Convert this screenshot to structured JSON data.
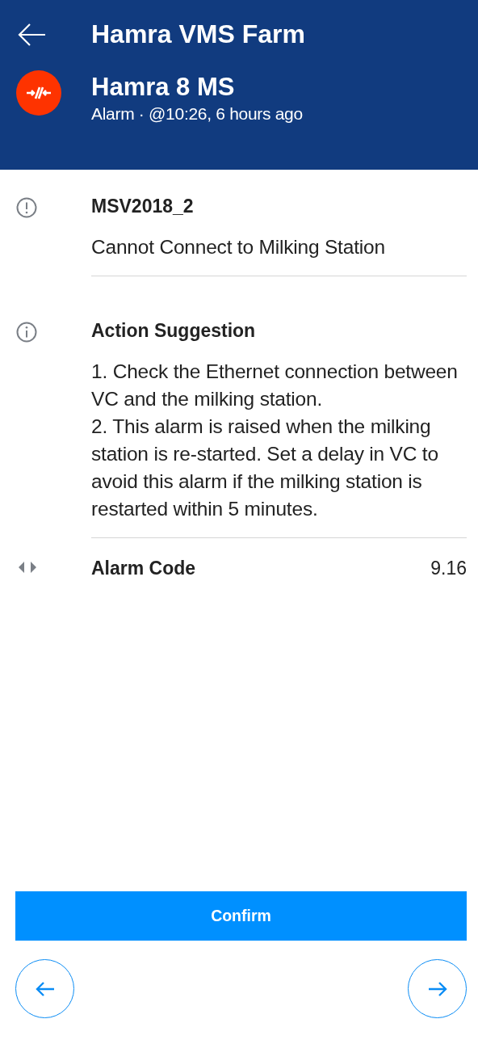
{
  "header": {
    "title": "Hamra VMS Farm",
    "device": "Hamra 8 MS",
    "subtitle": "Alarm · @10:26, 6 hours ago"
  },
  "sections": [
    {
      "kind": "alarm",
      "title": "MSV2018_2",
      "lines": [
        "Cannot Connect to Milking Station"
      ]
    },
    {
      "kind": "info",
      "title": "Action Suggestion",
      "lines": [
        "1. Check the Ethernet connection between VC and the milking station.",
        "2. This alarm is raised when the milking station is re-started. Set a delay in VC to avoid this alarm if the milking station is restarted within 5 minutes."
      ]
    },
    {
      "kind": "code",
      "title": "Alarm Code",
      "value": "9.16"
    }
  ],
  "confirm": "Confirm"
}
